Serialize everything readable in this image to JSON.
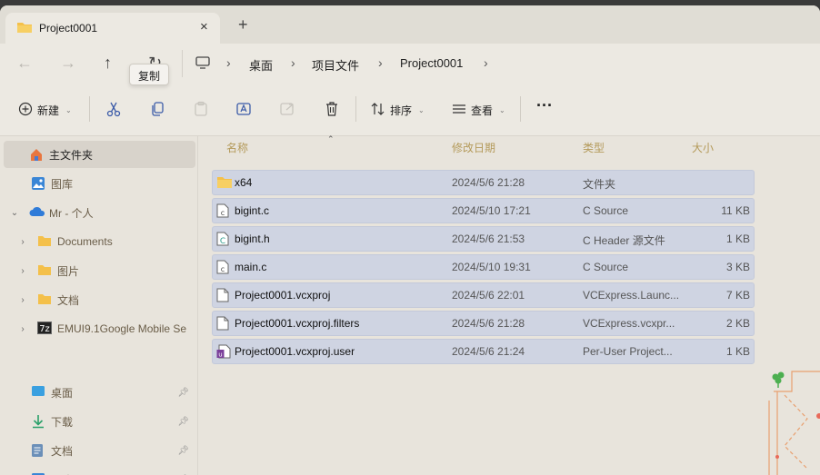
{
  "tab": {
    "title": "Project0001",
    "close": "×",
    "new_tab": "+"
  },
  "nav": {
    "back": "←",
    "forward": "→",
    "up": "↑",
    "refresh": "↻"
  },
  "tooltip": "复制",
  "breadcrumb": [
    "桌面",
    "项目文件",
    "Project0001"
  ],
  "toolbar": {
    "new_label": "新建",
    "sort_label": "排序",
    "view_label": "查看",
    "more_label": "···"
  },
  "sidebar": {
    "home": "主文件夹",
    "gallery": "图库",
    "account": "Mr - 个人",
    "folders": [
      "Documents",
      "图片",
      "文档",
      "EMUI9.1Google Mobile Se"
    ],
    "quick": [
      "桌面",
      "下载",
      "文档",
      "图片"
    ]
  },
  "columns": {
    "name": "名称",
    "modified": "修改日期",
    "type": "类型",
    "size": "大小"
  },
  "files": [
    {
      "name": "x64",
      "date": "2024/5/6 21:28",
      "type": "文件夹",
      "size": "",
      "icon": "folder-icon"
    },
    {
      "name": "bigint.c",
      "date": "2024/5/10 17:21",
      "type": "C Source",
      "size": "11 KB",
      "icon": "c-source-icon"
    },
    {
      "name": "bigint.h",
      "date": "2024/5/6 21:53",
      "type": "C Header 源文件",
      "size": "1 KB",
      "icon": "c-header-icon"
    },
    {
      "name": "main.c",
      "date": "2024/5/10 19:31",
      "type": "C Source",
      "size": "3 KB",
      "icon": "c-source-icon"
    },
    {
      "name": "Project0001.vcxproj",
      "date": "2024/5/6 22:01",
      "type": "VCExpress.Launc...",
      "size": "7 KB",
      "icon": "file-icon"
    },
    {
      "name": "Project0001.vcxproj.filters",
      "date": "2024/5/6 21:28",
      "type": "VCExpress.vcxpr...",
      "size": "2 KB",
      "icon": "file-icon"
    },
    {
      "name": "Project0001.vcxproj.user",
      "date": "2024/5/6 21:24",
      "type": "Per-User Project...",
      "size": "1 KB",
      "icon": "vs-user-icon"
    }
  ],
  "colors": {
    "selection": "#cfd4e2",
    "column_header": "#b49a5a",
    "folder": "#f4c04a",
    "window_bg": "#e8e4dc"
  }
}
